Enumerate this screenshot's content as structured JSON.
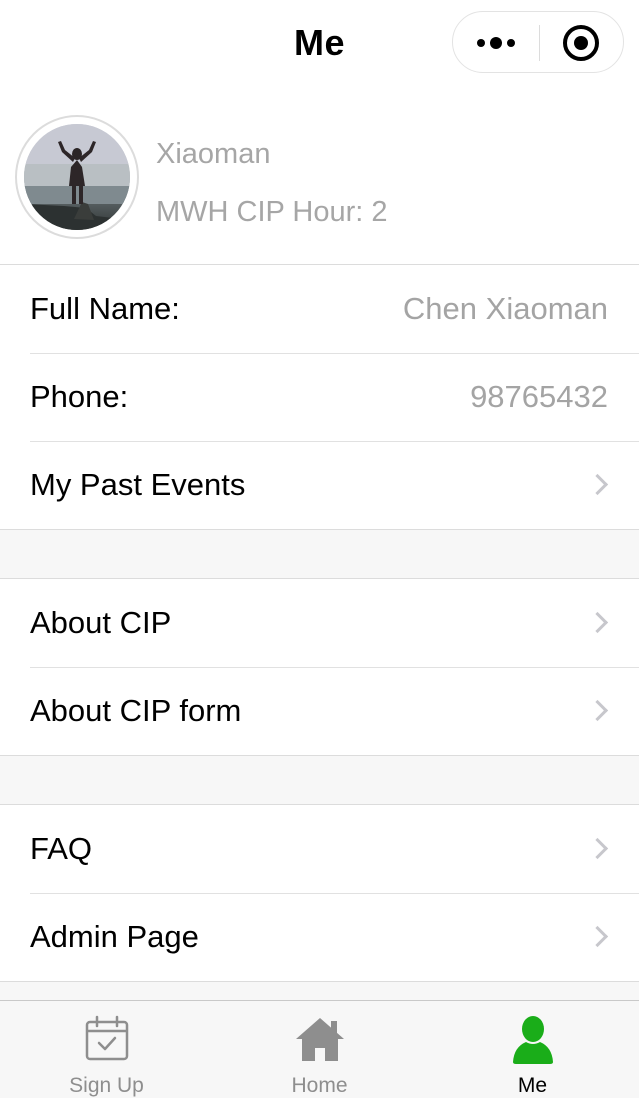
{
  "navbar": {
    "title": "Me",
    "more_icon": "more-dots-icon",
    "close_icon": "target-close-icon"
  },
  "profile": {
    "nickname": "Xiaoman",
    "cip_hours": "MWH CIP Hour: 2"
  },
  "info": {
    "full_name_label": "Full Name:",
    "full_name_value": "Chen Xiaoman",
    "phone_label": "Phone:",
    "phone_value": "98765432",
    "past_events_label": "My Past Events"
  },
  "about": {
    "about_cip": "About CIP",
    "about_cip_form": "About CIP form"
  },
  "help": {
    "faq": "FAQ",
    "admin_page": "Admin Page"
  },
  "tabbar": {
    "items": [
      {
        "label": "Sign Up",
        "icon": "calendar-check-icon"
      },
      {
        "label": "Home",
        "icon": "home-icon"
      },
      {
        "label": "Me",
        "icon": "person-icon"
      }
    ],
    "active_color": "#1aad19",
    "inactive_color": "#8e8e8e"
  }
}
